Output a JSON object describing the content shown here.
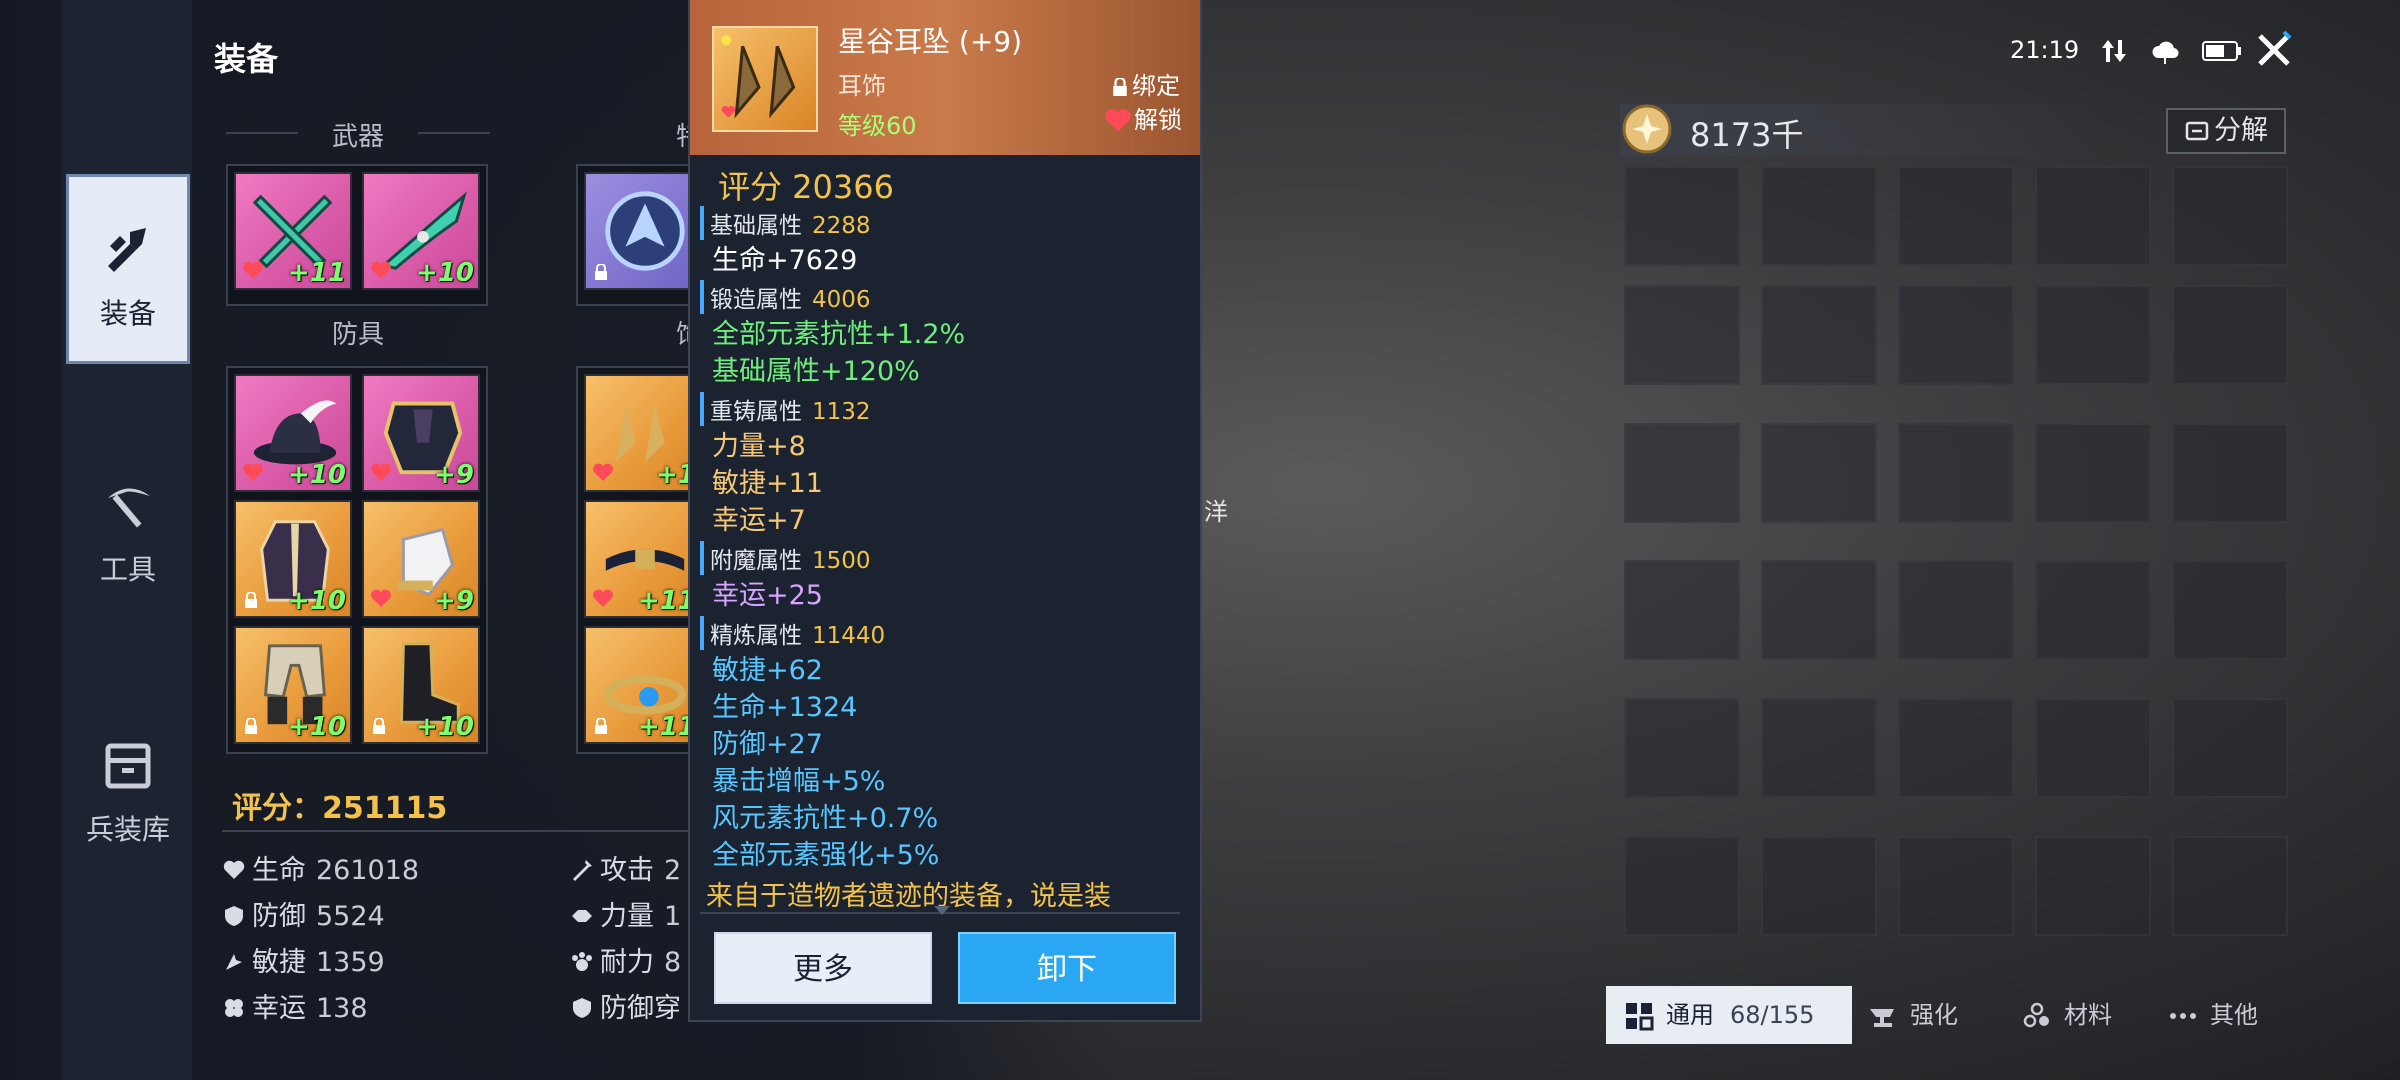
{
  "header": {
    "title": "装备"
  },
  "rail": {
    "tabs": [
      {
        "label": "装备",
        "icon": "equipment-icon",
        "active": true
      },
      {
        "label": "工具",
        "icon": "pickaxe-icon",
        "active": false
      },
      {
        "label": "兵装库",
        "icon": "armory-icon",
        "active": false
      }
    ]
  },
  "categories": {
    "weapon": "武器",
    "armor": "防具",
    "cut1": "特",
    "cut2": "饰"
  },
  "weapons": [
    {
      "level": "+11",
      "rarity": "pink"
    },
    {
      "level": "+10",
      "rarity": "pink"
    }
  ],
  "armor": [
    {
      "level": "+10",
      "rarity": "pink"
    },
    {
      "level": "+9",
      "rarity": "pink"
    },
    {
      "level": "+10",
      "rarity": "gold"
    },
    {
      "level": "+9",
      "rarity": "gold"
    },
    {
      "level": "+10",
      "rarity": "gold"
    },
    {
      "level": "+10",
      "rarity": "gold"
    }
  ],
  "accessories": [
    {
      "level": "+1",
      "rarity": "gold"
    },
    {
      "level": "+11",
      "rarity": "gold"
    },
    {
      "level": "+11",
      "rarity": "gold"
    }
  ],
  "character": {
    "score_label": "评分：251115",
    "stats": [
      {
        "name": "生命",
        "value": "261018",
        "icon": "life-icon"
      },
      {
        "name": "防御",
        "value": "5524",
        "icon": "defense-icon"
      },
      {
        "name": "敏捷",
        "value": "1359",
        "icon": "agility-icon"
      },
      {
        "name": "幸运",
        "value": "138",
        "icon": "luck-icon"
      },
      {
        "name": "攻击",
        "value": "2",
        "icon": "attack-icon"
      },
      {
        "name": "力量",
        "value": "1",
        "icon": "strength-icon"
      },
      {
        "name": "耐力",
        "value": "8",
        "icon": "stamina-icon"
      },
      {
        "name": "防御穿",
        "value": "",
        "icon": "penetration-icon"
      }
    ]
  },
  "tooltip": {
    "name": "星谷耳坠 (+9)",
    "type": "耳饰",
    "level": "等级60",
    "bind": "绑定",
    "unlock": "解锁",
    "score": "评分 20366",
    "base": {
      "label": "基础属性",
      "value": "2288",
      "lines": [
        "生命+7629"
      ]
    },
    "forge": {
      "label": "锻造属性",
      "value": "4006",
      "lines": [
        "全部元素抗性+1.2%",
        "基础属性+120%"
      ]
    },
    "recast": {
      "label": "重铸属性",
      "value": "1132",
      "lines": [
        "力量+8",
        "敏捷+11",
        "幸运+7"
      ]
    },
    "enchant": {
      "label": "附魔属性",
      "value": "1500",
      "lines": [
        "幸运+25"
      ]
    },
    "refine": {
      "label": "精炼属性",
      "value": "11440",
      "lines": [
        "敏捷+62",
        "生命+1324",
        "防御+27",
        "暴击增幅+5%",
        "风元素抗性+0.7%",
        "全部元素强化+5%"
      ]
    },
    "description": "来自于造物者遗迹的装备，说是装",
    "more_button": "更多",
    "unequip_button": "卸下"
  },
  "side_text": "洋",
  "status": {
    "time": "21:19"
  },
  "currency": {
    "value": "8173千",
    "decompose_label": "分解"
  },
  "bottom_tabs": [
    {
      "label": "通用",
      "count": "68/155",
      "icon": "grid-icon",
      "active": true
    },
    {
      "label": "强化",
      "count": "",
      "icon": "anvil-icon",
      "active": false
    },
    {
      "label": "材料",
      "count": "",
      "icon": "material-icon",
      "active": false
    },
    {
      "label": "其他",
      "count": "",
      "icon": "dots-icon",
      "active": false
    }
  ],
  "colors": {
    "accent": "#2aa7f2",
    "score": "#f2c24a",
    "level": "#7bff6a"
  }
}
